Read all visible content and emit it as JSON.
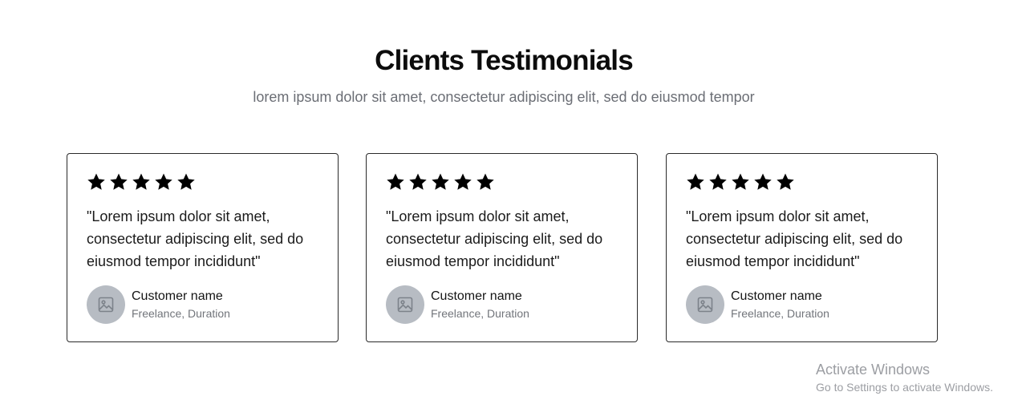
{
  "header": {
    "title": "Clients Testimonials",
    "subtitle": "lorem ipsum dolor sit amet, consectetur adipiscing elit, sed do eiusmod tempor"
  },
  "testimonials": [
    {
      "rating": 5,
      "quote": "\"Lorem ipsum dolor sit amet, consectetur adipiscing elit, sed do eiusmod tempor incididunt\"",
      "customer_name": "Customer name",
      "customer_role": "Freelance, Duration",
      "avatar_icon": "image-placeholder-icon"
    },
    {
      "rating": 5,
      "quote": "\"Lorem ipsum dolor sit amet, consectetur adipiscing elit, sed do eiusmod tempor incididunt\"",
      "customer_name": "Customer name",
      "customer_role": "Freelance, Duration",
      "avatar_icon": "image-placeholder-icon"
    },
    {
      "rating": 5,
      "quote": "\"Lorem ipsum dolor sit amet, consectetur adipiscing elit, sed do eiusmod tempor incididunt\"",
      "customer_name": "Customer name",
      "customer_role": "Freelance, Duration",
      "avatar_icon": "image-placeholder-icon"
    }
  ],
  "watermark": {
    "title": "Activate Windows",
    "subtitle": "Go to Settings to activate Windows."
  },
  "colors": {
    "star": "#000000",
    "avatar_bg": "#b7bcc3",
    "card_border": "#2a2a2a",
    "subtitle_text": "#6b6e75"
  }
}
